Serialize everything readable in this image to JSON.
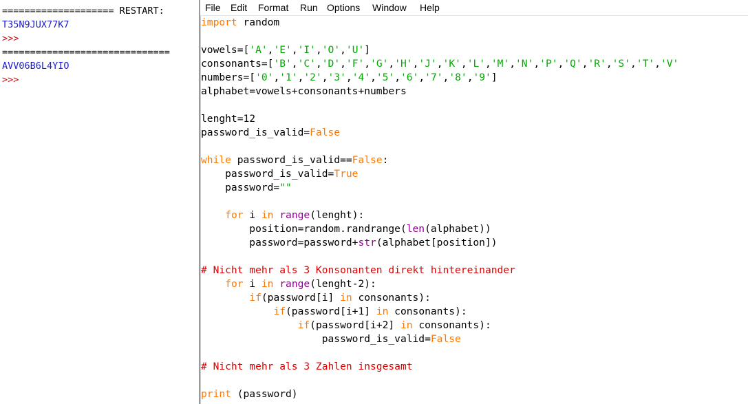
{
  "shell": {
    "restart_line_1": "==================== RESTART:",
    "output_1": "T35N9JUX77K7",
    "prompt_1": ">>>",
    "restart_line_2": "==============================",
    "output_2": "AVV06B6L4YIO",
    "prompt_2": ">>>"
  },
  "menu": {
    "items": [
      "File",
      "Edit",
      "Format",
      "Run",
      "Options",
      "Window",
      "Help"
    ]
  },
  "code": {
    "lines": [
      {
        "tokens": [
          {
            "t": "import",
            "c": "kw"
          },
          {
            "t": " random",
            "c": ""
          }
        ]
      },
      {
        "tokens": []
      },
      {
        "tokens": [
          {
            "t": "vowels=[",
            "c": ""
          },
          {
            "t": "'A'",
            "c": "str"
          },
          {
            "t": ",",
            "c": ""
          },
          {
            "t": "'E'",
            "c": "str"
          },
          {
            "t": ",",
            "c": ""
          },
          {
            "t": "'I'",
            "c": "str"
          },
          {
            "t": ",",
            "c": ""
          },
          {
            "t": "'O'",
            "c": "str"
          },
          {
            "t": ",",
            "c": ""
          },
          {
            "t": "'U'",
            "c": "str"
          },
          {
            "t": "]",
            "c": ""
          }
        ]
      },
      {
        "tokens": [
          {
            "t": "consonants=[",
            "c": ""
          },
          {
            "t": "'B'",
            "c": "str"
          },
          {
            "t": ",",
            "c": ""
          },
          {
            "t": "'C'",
            "c": "str"
          },
          {
            "t": ",",
            "c": ""
          },
          {
            "t": "'D'",
            "c": "str"
          },
          {
            "t": ",",
            "c": ""
          },
          {
            "t": "'F'",
            "c": "str"
          },
          {
            "t": ",",
            "c": ""
          },
          {
            "t": "'G'",
            "c": "str"
          },
          {
            "t": ",",
            "c": ""
          },
          {
            "t": "'H'",
            "c": "str"
          },
          {
            "t": ",",
            "c": ""
          },
          {
            "t": "'J'",
            "c": "str"
          },
          {
            "t": ",",
            "c": ""
          },
          {
            "t": "'K'",
            "c": "str"
          },
          {
            "t": ",",
            "c": ""
          },
          {
            "t": "'L'",
            "c": "str"
          },
          {
            "t": ",",
            "c": ""
          },
          {
            "t": "'M'",
            "c": "str"
          },
          {
            "t": ",",
            "c": ""
          },
          {
            "t": "'N'",
            "c": "str"
          },
          {
            "t": ",",
            "c": ""
          },
          {
            "t": "'P'",
            "c": "str"
          },
          {
            "t": ",",
            "c": ""
          },
          {
            "t": "'Q'",
            "c": "str"
          },
          {
            "t": ",",
            "c": ""
          },
          {
            "t": "'R'",
            "c": "str"
          },
          {
            "t": ",",
            "c": ""
          },
          {
            "t": "'S'",
            "c": "str"
          },
          {
            "t": ",",
            "c": ""
          },
          {
            "t": "'T'",
            "c": "str"
          },
          {
            "t": ",",
            "c": ""
          },
          {
            "t": "'V'",
            "c": "str"
          }
        ]
      },
      {
        "tokens": [
          {
            "t": "numbers=[",
            "c": ""
          },
          {
            "t": "'0'",
            "c": "str"
          },
          {
            "t": ",",
            "c": ""
          },
          {
            "t": "'1'",
            "c": "str"
          },
          {
            "t": ",",
            "c": ""
          },
          {
            "t": "'2'",
            "c": "str"
          },
          {
            "t": ",",
            "c": ""
          },
          {
            "t": "'3'",
            "c": "str"
          },
          {
            "t": ",",
            "c": ""
          },
          {
            "t": "'4'",
            "c": "str"
          },
          {
            "t": ",",
            "c": ""
          },
          {
            "t": "'5'",
            "c": "str"
          },
          {
            "t": ",",
            "c": ""
          },
          {
            "t": "'6'",
            "c": "str"
          },
          {
            "t": ",",
            "c": ""
          },
          {
            "t": "'7'",
            "c": "str"
          },
          {
            "t": ",",
            "c": ""
          },
          {
            "t": "'8'",
            "c": "str"
          },
          {
            "t": ",",
            "c": ""
          },
          {
            "t": "'9'",
            "c": "str"
          },
          {
            "t": "]",
            "c": ""
          }
        ]
      },
      {
        "tokens": [
          {
            "t": "alphabet=vowels+consonants+numbers",
            "c": ""
          }
        ]
      },
      {
        "tokens": []
      },
      {
        "tokens": [
          {
            "t": "lenght=12",
            "c": ""
          }
        ]
      },
      {
        "tokens": [
          {
            "t": "password_is_valid=",
            "c": ""
          },
          {
            "t": "False",
            "c": "kw"
          }
        ]
      },
      {
        "tokens": []
      },
      {
        "tokens": [
          {
            "t": "while",
            "c": "kw"
          },
          {
            "t": " password_is_valid==",
            "c": ""
          },
          {
            "t": "False",
            "c": "kw"
          },
          {
            "t": ":",
            "c": ""
          }
        ]
      },
      {
        "tokens": [
          {
            "t": "    password_is_valid=",
            "c": ""
          },
          {
            "t": "True",
            "c": "kw"
          }
        ]
      },
      {
        "tokens": [
          {
            "t": "    password=",
            "c": ""
          },
          {
            "t": "\"\"",
            "c": "str"
          }
        ]
      },
      {
        "tokens": []
      },
      {
        "tokens": [
          {
            "t": "    ",
            "c": ""
          },
          {
            "t": "for",
            "c": "kw"
          },
          {
            "t": " i ",
            "c": ""
          },
          {
            "t": "in",
            "c": "kw"
          },
          {
            "t": " ",
            "c": ""
          },
          {
            "t": "range",
            "c": "bi"
          },
          {
            "t": "(lenght):",
            "c": ""
          }
        ]
      },
      {
        "tokens": [
          {
            "t": "        position=random.randrange(",
            "c": ""
          },
          {
            "t": "len",
            "c": "bi"
          },
          {
            "t": "(alphabet))",
            "c": ""
          }
        ]
      },
      {
        "tokens": [
          {
            "t": "        password=password+",
            "c": ""
          },
          {
            "t": "str",
            "c": "bi"
          },
          {
            "t": "(alphabet[position])",
            "c": ""
          }
        ]
      },
      {
        "tokens": []
      },
      {
        "tokens": [
          {
            "t": "# Nicht mehr als 3 Konsonanten direkt hintereinander",
            "c": "cm"
          }
        ]
      },
      {
        "tokens": [
          {
            "t": "    ",
            "c": ""
          },
          {
            "t": "for",
            "c": "kw"
          },
          {
            "t": " i ",
            "c": ""
          },
          {
            "t": "in",
            "c": "kw"
          },
          {
            "t": " ",
            "c": ""
          },
          {
            "t": "range",
            "c": "bi"
          },
          {
            "t": "(lenght-2):",
            "c": ""
          }
        ]
      },
      {
        "tokens": [
          {
            "t": "        ",
            "c": ""
          },
          {
            "t": "if",
            "c": "kw"
          },
          {
            "t": "(password[i] ",
            "c": ""
          },
          {
            "t": "in",
            "c": "kw"
          },
          {
            "t": " consonants):",
            "c": ""
          }
        ]
      },
      {
        "tokens": [
          {
            "t": "            ",
            "c": ""
          },
          {
            "t": "if",
            "c": "kw"
          },
          {
            "t": "(password[i+1] ",
            "c": ""
          },
          {
            "t": "in",
            "c": "kw"
          },
          {
            "t": " consonants):",
            "c": ""
          }
        ]
      },
      {
        "tokens": [
          {
            "t": "                ",
            "c": ""
          },
          {
            "t": "if",
            "c": "kw"
          },
          {
            "t": "(password[i+2] ",
            "c": ""
          },
          {
            "t": "in",
            "c": "kw"
          },
          {
            "t": " consonants):",
            "c": ""
          }
        ]
      },
      {
        "tokens": [
          {
            "t": "                    password_is_valid=",
            "c": ""
          },
          {
            "t": "False",
            "c": "kw"
          }
        ]
      },
      {
        "tokens": []
      },
      {
        "tokens": [
          {
            "t": "# Nicht mehr als 3 Zahlen insgesamt",
            "c": "cm"
          }
        ]
      },
      {
        "tokens": []
      },
      {
        "tokens": [
          {
            "t": "print",
            "c": "kw"
          },
          {
            "t": " (password)",
            "c": ""
          }
        ]
      }
    ]
  },
  "colors": {
    "keyword": "#ff7700",
    "string": "#00aa00",
    "builtin": "#900090",
    "comment": "#dd0000",
    "shell_output": "#1a1ad0",
    "shell_prompt": "#c81414"
  }
}
